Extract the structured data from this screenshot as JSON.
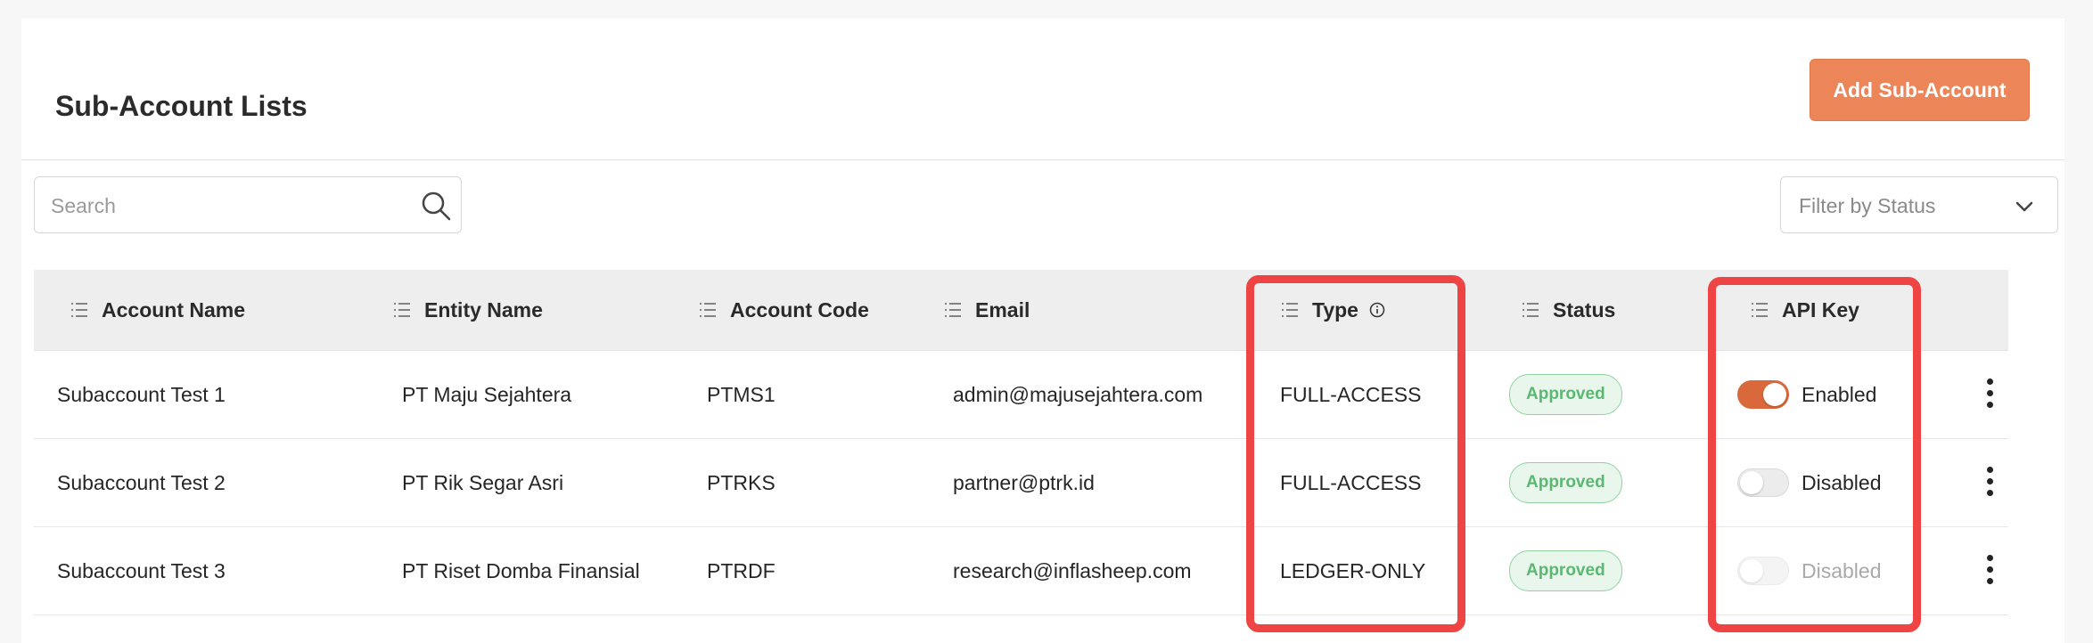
{
  "header": {
    "title": "Sub-Account Lists",
    "add_button": "Add Sub-Account"
  },
  "search": {
    "placeholder": "Search"
  },
  "filter": {
    "placeholder": "Filter by Status"
  },
  "table": {
    "columns": [
      "Account Name",
      "Entity Name",
      "Account Code",
      "Email",
      "Type",
      "Status",
      "API Key"
    ],
    "rows": [
      {
        "account_name": "Subaccount Test 1",
        "entity_name": "PT Maju Sejahtera",
        "account_code": "PTMS1",
        "email": "admin@majusejahtera.com",
        "type": "FULL-ACCESS",
        "status": "Approved",
        "api_key": "Enabled",
        "api_key_on": true,
        "api_key_disabled": false
      },
      {
        "account_name": "Subaccount Test 2",
        "entity_name": "PT Rik Segar Asri",
        "account_code": "PTRKS",
        "email": "partner@ptrk.id",
        "type": "FULL-ACCESS",
        "status": "Approved",
        "api_key": "Disabled",
        "api_key_on": false,
        "api_key_disabled": false
      },
      {
        "account_name": "Subaccount Test 3",
        "entity_name": "PT Riset Domba Finansial",
        "account_code": "PTRDF",
        "email": "research@inflasheep.com",
        "type": "LEDGER-ONLY",
        "status": "Approved",
        "api_key": "Disabled",
        "api_key_on": false,
        "api_key_disabled": true
      }
    ]
  },
  "colors": {
    "accent": "#ec8658",
    "highlight": "#ee4444",
    "badge_text": "#5bb872",
    "toggle_on": "#d9683b"
  },
  "icons": {
    "search": "search-icon",
    "filter": "chevron-down-icon",
    "sort": "sort-icon",
    "info": "info-icon",
    "more": "more-vertical-icon"
  }
}
